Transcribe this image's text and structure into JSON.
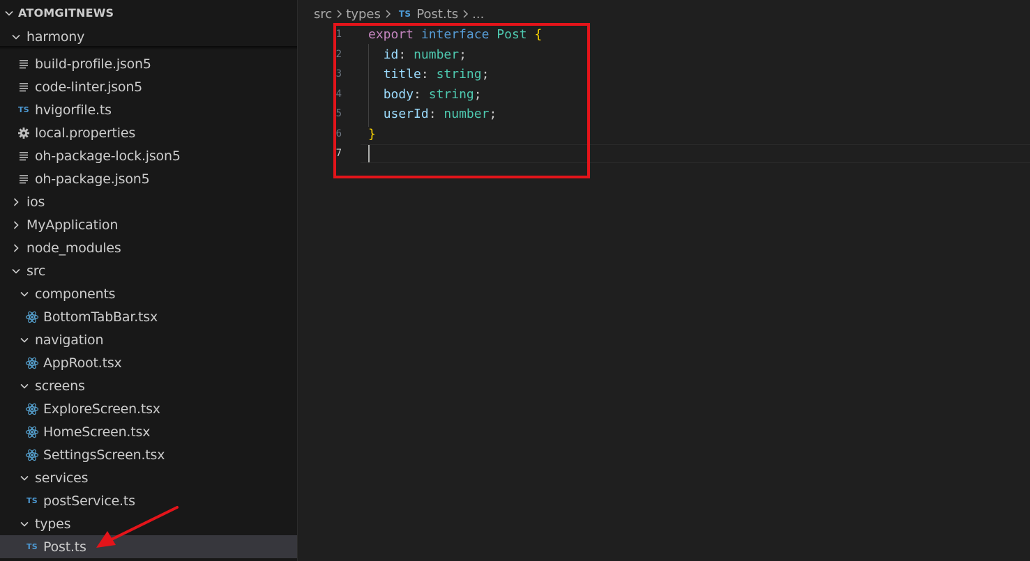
{
  "explorer": {
    "root": "ATOMGITNEWS",
    "items": [
      {
        "label": "harmony",
        "kind": "folder",
        "expanded": true,
        "depth": 0,
        "icon": "chevron-down-icon"
      },
      {
        "label": "build-profile.json5",
        "kind": "file",
        "depth": 1,
        "icon": "json-lines-icon"
      },
      {
        "label": "code-linter.json5",
        "kind": "file",
        "depth": 1,
        "icon": "json-lines-icon"
      },
      {
        "label": "hvigorfile.ts",
        "kind": "file",
        "depth": 1,
        "icon": "typescript-icon",
        "badge": "TS"
      },
      {
        "label": "local.properties",
        "kind": "file",
        "depth": 1,
        "icon": "gear-icon"
      },
      {
        "label": "oh-package-lock.json5",
        "kind": "file",
        "depth": 1,
        "icon": "json-lines-icon"
      },
      {
        "label": "oh-package.json5",
        "kind": "file",
        "depth": 1,
        "icon": "json-lines-icon"
      },
      {
        "label": "ios",
        "kind": "folder",
        "expanded": false,
        "depth": 0,
        "icon": "chevron-right-icon"
      },
      {
        "label": "MyApplication",
        "kind": "folder",
        "expanded": false,
        "depth": 0,
        "icon": "chevron-right-icon"
      },
      {
        "label": "node_modules",
        "kind": "folder",
        "expanded": false,
        "depth": 0,
        "icon": "chevron-right-icon"
      },
      {
        "label": "src",
        "kind": "folder",
        "expanded": true,
        "depth": 0,
        "icon": "chevron-down-icon"
      },
      {
        "label": "components",
        "kind": "folder",
        "expanded": true,
        "depth": 1,
        "icon": "chevron-down-icon"
      },
      {
        "label": "BottomTabBar.tsx",
        "kind": "file",
        "depth": 2,
        "icon": "react-icon"
      },
      {
        "label": "navigation",
        "kind": "folder",
        "expanded": true,
        "depth": 1,
        "icon": "chevron-down-icon"
      },
      {
        "label": "AppRoot.tsx",
        "kind": "file",
        "depth": 2,
        "icon": "react-icon"
      },
      {
        "label": "screens",
        "kind": "folder",
        "expanded": true,
        "depth": 1,
        "icon": "chevron-down-icon"
      },
      {
        "label": "ExploreScreen.tsx",
        "kind": "file",
        "depth": 2,
        "icon": "react-icon"
      },
      {
        "label": "HomeScreen.tsx",
        "kind": "file",
        "depth": 2,
        "icon": "react-icon"
      },
      {
        "label": "SettingsScreen.tsx",
        "kind": "file",
        "depth": 2,
        "icon": "react-icon"
      },
      {
        "label": "services",
        "kind": "folder",
        "expanded": true,
        "depth": 1,
        "icon": "chevron-down-icon"
      },
      {
        "label": "postService.ts",
        "kind": "file",
        "depth": 2,
        "icon": "typescript-icon",
        "badge": "TS"
      },
      {
        "label": "types",
        "kind": "folder",
        "expanded": true,
        "depth": 1,
        "icon": "chevron-down-icon"
      },
      {
        "label": "Post.ts",
        "kind": "file",
        "depth": 2,
        "icon": "typescript-icon",
        "badge": "TS",
        "selected": true
      }
    ]
  },
  "breadcrumb": {
    "segments": [
      "src",
      "types",
      "Post.ts",
      "..."
    ],
    "file_badge": "TS"
  },
  "editor": {
    "line_numbers": [
      "1",
      "2",
      "3",
      "4",
      "5",
      "6",
      "7"
    ],
    "active_line": "7",
    "code": {
      "l1": {
        "export": "export",
        "interface": "interface",
        "name": "Post",
        "brace": "{"
      },
      "l2": {
        "prop": "id",
        "colon": ":",
        "type": "number",
        "semi": ";"
      },
      "l3": {
        "prop": "title",
        "colon": ":",
        "type": "string",
        "semi": ";"
      },
      "l4": {
        "prop": "body",
        "colon": ":",
        "type": "string",
        "semi": ";"
      },
      "l5": {
        "prop": "userId",
        "colon": ":",
        "type": "number",
        "semi": ";"
      },
      "l6": {
        "brace": "}"
      }
    }
  },
  "colors": {
    "sidebar_bg": "#181818",
    "editor_bg": "#1f1f1f",
    "selected_row": "#37373d",
    "ts_badge": "#4d9bd6",
    "react_icon": "#58a6d6",
    "annotation_red": "#e3141a"
  }
}
